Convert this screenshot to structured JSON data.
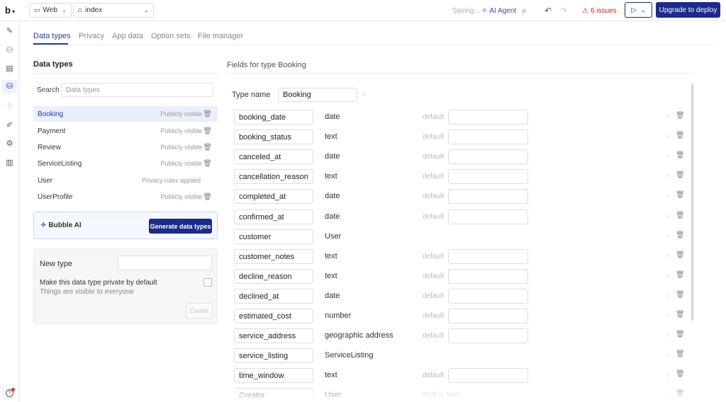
{
  "topbar": {
    "logo": "b",
    "platform": "Web",
    "page": "index",
    "saving": "Saving...",
    "ai_agent": "AI Agent",
    "issues": "6 issues",
    "deploy": "Upgrade to deploy"
  },
  "tabs": [
    "Data types",
    "Privacy",
    "App data",
    "Option sets",
    "File manager"
  ],
  "left": {
    "heading": "Data types",
    "search_label": "Search",
    "search_placeholder": "Data types",
    "types": [
      {
        "name": "Booking",
        "visibility": "Publicly visible"
      },
      {
        "name": "Payment",
        "visibility": "Publicly visible"
      },
      {
        "name": "Review",
        "visibility": "Publicly visible"
      },
      {
        "name": "ServiceListing",
        "visibility": "Publicly visible"
      },
      {
        "name": "User",
        "visibility": "Privacy rules applied"
      },
      {
        "name": "UserProfile",
        "visibility": "Publicly visible"
      }
    ],
    "ai_label": "Bubble AI",
    "generate": "Generate data types",
    "new_type_label": "New type",
    "private_label": "Make this data type private by default",
    "private_sub": "Things are visible to everyone",
    "create": "Create"
  },
  "right": {
    "heading": "Fields for type Booking",
    "type_name_label": "Type name",
    "type_name": "Booking",
    "default_label": "default",
    "builtin_label": "Built-in field",
    "fields": [
      {
        "name": "booking_date",
        "type": "date",
        "has_default": true
      },
      {
        "name": "booking_status",
        "type": "text",
        "has_default": true
      },
      {
        "name": "canceled_at",
        "type": "date",
        "has_default": true
      },
      {
        "name": "cancellation_reason",
        "type": "text",
        "has_default": true
      },
      {
        "name": "completed_at",
        "type": "date",
        "has_default": true
      },
      {
        "name": "confirmed_at",
        "type": "date",
        "has_default": true
      },
      {
        "name": "customer",
        "type": "User",
        "has_default": false
      },
      {
        "name": "customer_notes",
        "type": "text",
        "has_default": true
      },
      {
        "name": "decline_reason",
        "type": "text",
        "has_default": true
      },
      {
        "name": "declined_at",
        "type": "date",
        "has_default": true
      },
      {
        "name": "estimated_cost",
        "type": "number",
        "has_default": true
      },
      {
        "name": "service_address",
        "type": "geographic address",
        "has_default": true
      },
      {
        "name": "service_listing",
        "type": "ServiceListing",
        "has_default": false
      },
      {
        "name": "time_window",
        "type": "text",
        "has_default": true
      },
      {
        "name": "Creator",
        "type": "User",
        "has_default": false,
        "builtin": true
      }
    ]
  },
  "colors": {
    "accent": "#2d3a9c",
    "primary_button": "#1c2a8c",
    "issues": "#b4261e"
  }
}
